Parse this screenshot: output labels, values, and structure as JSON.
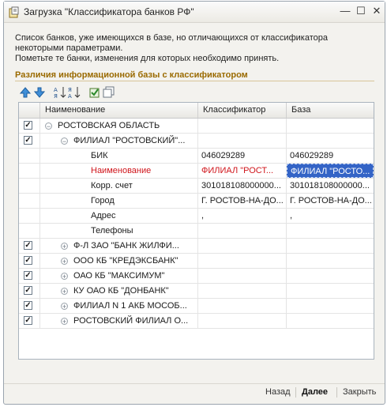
{
  "window": {
    "title": "Загрузка \"Классификатора банков РФ\""
  },
  "description": {
    "line1": "Список банков, уже имеющихся в базе, но отличающихся от классификатора",
    "line2": "некоторыми параметрами.",
    "line3": "Пометьте те банки, изменения для которых необходимо принять."
  },
  "section_title": "Различия информационной базы с классификатором",
  "toolbar": [
    "move-up-icon",
    "move-down-icon",
    "sort-asc-icon",
    "sort-desc-icon",
    "check-all-icon",
    "uncheck-all-icon"
  ],
  "table": {
    "headers": {
      "name": "Наименование",
      "classifier": "Классификатор",
      "base": "База"
    },
    "rows": [
      {
        "checked": true,
        "expander": "⊖",
        "indent": 0,
        "name": "РОСТОВСКАЯ ОБЛАСТЬ",
        "classifier": "",
        "base": ""
      },
      {
        "checked": true,
        "expander": "⊖",
        "indent": 1,
        "name": "ФИЛИАЛ \"РОСТОВСКИЙ\"...",
        "classifier": "",
        "base": ""
      },
      {
        "checked": null,
        "expander": "",
        "indent": 2,
        "name": "БИК",
        "classifier": "046029289",
        "base": "046029289"
      },
      {
        "checked": null,
        "expander": "",
        "indent": 2,
        "name": "Наименование",
        "classifier": "ФИЛИАЛ \"РОСТ...",
        "base": "ФИЛИАЛ \"РОСТО...",
        "highlight": true
      },
      {
        "checked": null,
        "expander": "",
        "indent": 2,
        "name": "Корр. счет",
        "classifier": "301018108000000...",
        "base": "301018108000000..."
      },
      {
        "checked": null,
        "expander": "",
        "indent": 2,
        "name": "Город",
        "classifier": "Г. РОСТОВ-НА-ДО...",
        "base": "Г. РОСТОВ-НА-ДО..."
      },
      {
        "checked": null,
        "expander": "",
        "indent": 2,
        "name": "Адрес",
        "classifier": ",",
        "base": ","
      },
      {
        "checked": null,
        "expander": "",
        "indent": 2,
        "name": "Телефоны",
        "classifier": "",
        "base": ""
      },
      {
        "checked": true,
        "expander": "⊕",
        "indent": 1,
        "name": "Ф-Л ЗАО \"БАНК ЖИЛФИ...",
        "classifier": "",
        "base": ""
      },
      {
        "checked": true,
        "expander": "⊕",
        "indent": 1,
        "name": "ООО КБ \"КРЕДЭКСБАНК\"",
        "classifier": "",
        "base": ""
      },
      {
        "checked": true,
        "expander": "⊕",
        "indent": 1,
        "name": "ОАО КБ \"МАКСИМУМ\"",
        "classifier": "",
        "base": ""
      },
      {
        "checked": true,
        "expander": "⊕",
        "indent": 1,
        "name": "КУ ОАО КБ \"ДОНБАНК\"",
        "classifier": "",
        "base": ""
      },
      {
        "checked": true,
        "expander": "⊕",
        "indent": 1,
        "name": "ФИЛИАЛ N 1 АКБ МОСОБ...",
        "classifier": "",
        "base": ""
      },
      {
        "checked": true,
        "expander": "⊕",
        "indent": 1,
        "name": "РОСТОВСКИЙ ФИЛИАЛ О...",
        "classifier": "",
        "base": ""
      }
    ]
  },
  "footer": {
    "back": "Назад",
    "next": "Далее",
    "close": "Закрыть"
  },
  "colors": {
    "accent_title": "#9a6a00",
    "selection": "#3464c6",
    "changed_text": "#d0161c"
  }
}
